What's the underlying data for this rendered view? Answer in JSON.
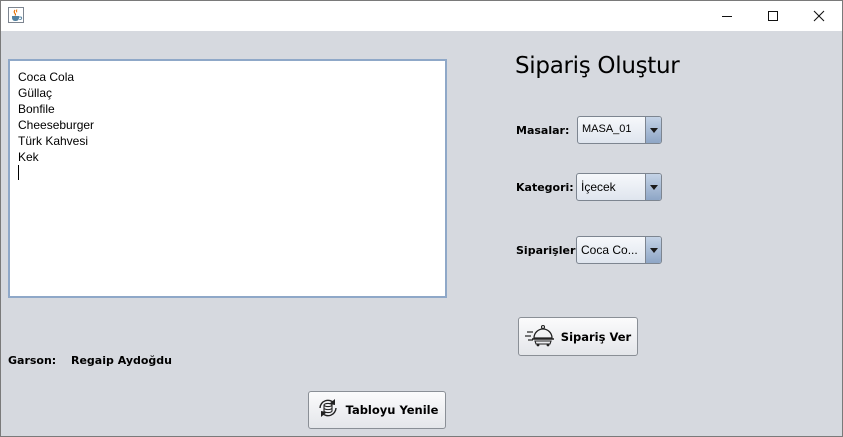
{
  "window": {
    "controls": {
      "minimize": "minimize-icon",
      "maximize": "maximize-icon",
      "close": "close-icon"
    }
  },
  "orders_list": {
    "items": [
      "Coca Cola",
      "Güllaç",
      "Bonfile",
      "Cheeseburger",
      "Türk Kahvesi",
      "Kek"
    ]
  },
  "form": {
    "title": "Sipariş Oluştur",
    "masalar": {
      "label": "Masalar:",
      "value": "MASA_01"
    },
    "kategori": {
      "label": "Kategori:",
      "value": "İçecek"
    },
    "siparisler": {
      "label": "Siparişler:",
      "value": "Coca Co..."
    },
    "order_button": {
      "label": "Sipariş Ver",
      "icon": "food-delivery-icon"
    }
  },
  "waiter": {
    "label": "Garson:",
    "name": "Regaip Aydoğdu"
  },
  "refresh_button": {
    "label": "Tabloyu Yenile",
    "icon": "database-refresh-icon"
  },
  "colors": {
    "panel_bg": "#d6d9df",
    "accent_border": "#8fa8c8",
    "combo_arrow": "#8ea6c6"
  }
}
